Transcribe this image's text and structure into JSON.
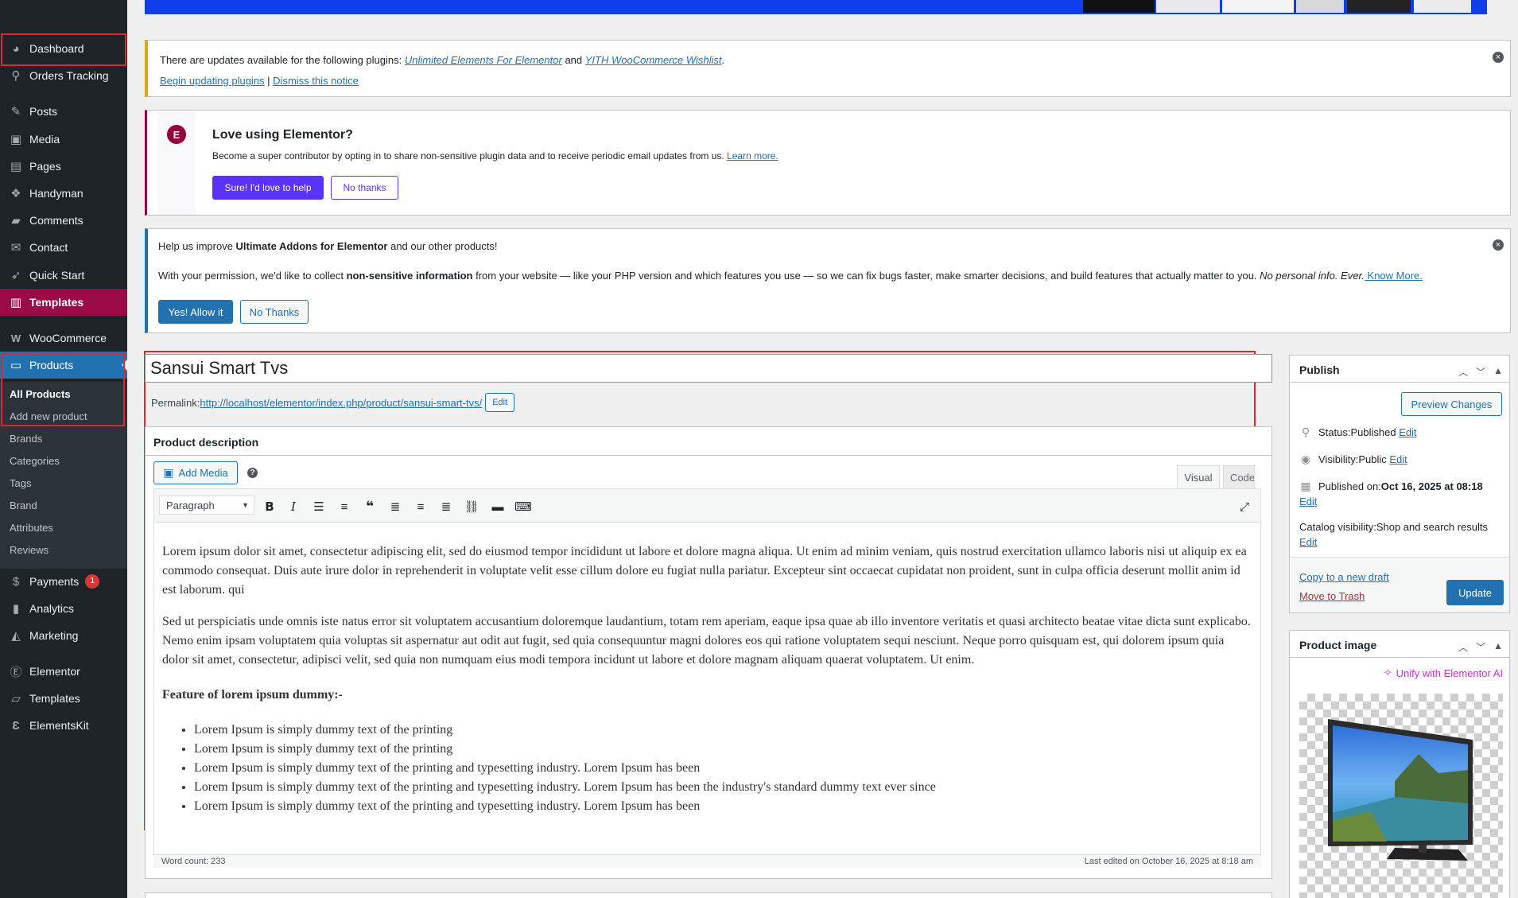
{
  "sidebar": {
    "dashboard": "Dashboard",
    "orders_tracking": "Orders Tracking",
    "posts": "Posts",
    "media": "Media",
    "pages": "Pages",
    "handyman": "Handyman",
    "comments": "Comments",
    "contact": "Contact",
    "quick_start": "Quick Start",
    "templates": "Templates",
    "woocommerce": "WooCommerce",
    "products": "Products",
    "sub_all_products": "All Products",
    "sub_add_new": "Add new product",
    "sub_brands": "Brands",
    "sub_categories": "Categories",
    "sub_tags": "Tags",
    "sub_brand": "Brand",
    "sub_attributes": "Attributes",
    "sub_reviews": "Reviews",
    "payments": "Payments",
    "payments_badge": "1",
    "analytics": "Analytics",
    "marketing": "Marketing",
    "elementor": "Elementor",
    "templates2": "Templates",
    "elementskit": "ElementsKit"
  },
  "notice_updates": {
    "text_pre": "There are updates available for the following plugins: ",
    "plugin1": "Unlimited Elements For Elementor",
    "and": " and ",
    "plugin2": "YITH WooCommerce Wishlist",
    "period": ".",
    "begin": "Begin updating plugins",
    "sep": " | ",
    "dismiss": "Dismiss this notice",
    "close": "×"
  },
  "notice_elementor": {
    "title": "Love using Elementor?",
    "text": "Become a super contributor by opting in to share non-sensitive plugin data and to receive periodic email updates from us. ",
    "learn_more": "Learn more.",
    "yes_btn": "Sure! I'd love to help",
    "no_btn": "No thanks"
  },
  "notice_uae": {
    "line1_pre": "Help us improve ",
    "line1_bold": "Ultimate Addons for Elementor",
    "line1_post": " and our other products!",
    "line2_pre": "With your permission, we'd like to collect ",
    "line2_bold": "non-sensitive information",
    "line2_mid": " from your website — like your PHP version and which features you use — so we can fix bugs faster, make smarter decisions, and build features that actually matter to you. ",
    "line2_italic": "No personal info. Ever.",
    "know_more": " Know More.",
    "allow_btn": "Yes! Allow it",
    "no_btn": "No Thanks",
    "close": "×"
  },
  "editor": {
    "title": "Sansui Smart Tvs",
    "permalink_label": "Permalink: ",
    "permalink_url": "http://localhost/elementor/index.php/product/sansui-smart-tvs/",
    "edit_btn": "Edit",
    "section_title": "Product description",
    "add_media": "Add Media",
    "help": "?",
    "tab_visual": "Visual",
    "tab_code": "Code",
    "format_select": "Paragraph",
    "para1": "Lorem ipsum dolor sit amet, consectetur adipiscing elit, sed do eiusmod tempor incididunt ut labore et dolore magna aliqua. Ut enim ad minim veniam, quis nostrud exercitation ullamco laboris nisi ut aliquip ex ea commodo consequat. Duis aute irure dolor in reprehenderit in voluptate velit esse cillum dolore eu fugiat nulla pariatur. Excepteur sint occaecat cupidatat non proident, sunt in culpa officia deserunt mollit anim id est laborum. qui",
    "para2": "Sed ut perspiciatis unde omnis iste natus error sit voluptatem accusantium doloremque laudantium, totam rem aperiam, eaque ipsa quae ab illo inventore veritatis et quasi architecto beatae vitae dicta sunt explicabo. Nemo enim ipsam voluptatem quia voluptas sit aspernatur aut odit aut fugit, sed quia consequuntur magni dolores eos qui ratione voluptatem sequi nesciunt. Neque porro quisquam est, qui dolorem ipsum quia dolor sit amet, consectetur, adipisci velit, sed quia non numquam eius modi tempora incidunt ut labore et dolore magnam aliquam quaerat voluptatem. Ut enim.",
    "feature_heading": "Feature of lorem ipsum dummy:-",
    "bullets": [
      "Lorem Ipsum is simply dummy text of the printing",
      "Lorem Ipsum is simply dummy text of the printing",
      "Lorem Ipsum is simply dummy text of the printing and typesetting industry. Lorem Ipsum has been",
      "Lorem Ipsum is simply dummy text of the printing and typesetting industry. Lorem Ipsum has been the industry's standard dummy text ever since",
      "Lorem Ipsum is simply dummy text of the printing and typesetting industry. Lorem Ipsum has been"
    ],
    "word_count": "Word count: 233",
    "last_edited": "Last edited on October 16, 2025 at 8:18 am"
  },
  "publish": {
    "title": "Publish",
    "preview": "Preview Changes",
    "status_label": "Status: ",
    "status_value": "Published",
    "visibility_label": "Visibility: ",
    "visibility_value": "Public",
    "published_label": "Published on: ",
    "published_value": "Oct 16, 2025 at 08:18",
    "catalog_label": "Catalog visibility: ",
    "catalog_value": "Shop and search results",
    "edit": "Edit",
    "copy_draft": "Copy to a new draft",
    "trash": "Move to Trash",
    "update": "Update"
  },
  "product_image": {
    "title": "Product image",
    "unify": "Unify with Elementor AI"
  },
  "colors": {
    "sidebar_bg": "#1d2327",
    "accent_blue": "#2271b1",
    "templates_active": "#9b0a46",
    "highlight_red": "#e0262c",
    "elementor_btn": "#5a32f8"
  }
}
